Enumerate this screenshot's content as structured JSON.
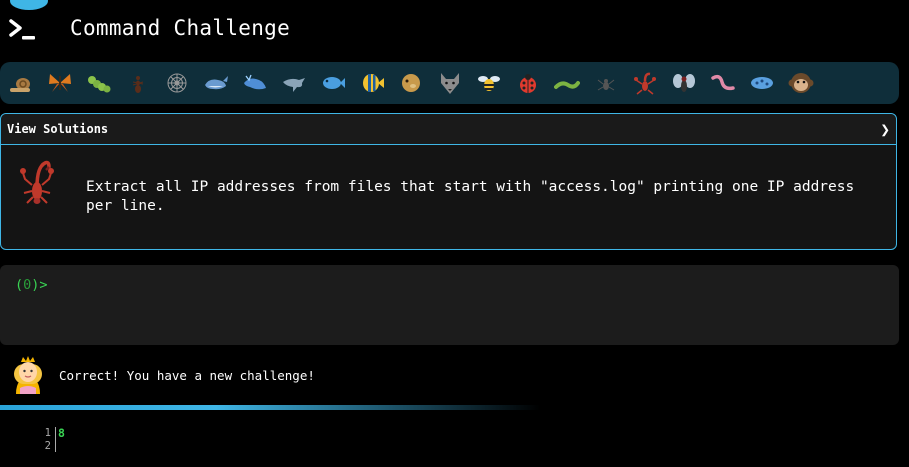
{
  "app": {
    "title": "Command Challenge"
  },
  "icon_strip": [
    "snail-icon",
    "butterfly-icon",
    "caterpillar-icon",
    "ant-icon",
    "spider-web-icon",
    "whale-icon",
    "whale-blue-icon",
    "dolphin-icon",
    "fish-icon",
    "tropical-fish-icon",
    "blowfish-icon",
    "wolf-icon",
    "bee-icon",
    "ladybug-icon",
    "worm-icon",
    "spider-icon",
    "scorpion-icon",
    "fly-icon",
    "earthworm-icon",
    "microbe-icon",
    "monkey-icon"
  ],
  "solutions_panel": {
    "header": "View Solutions",
    "chevron": "❯",
    "challenge": "Extract all IP addresses from files that start with \"access.log\" printing one IP address per line."
  },
  "terminal": {
    "prompt_open": "(",
    "prompt_count": "0",
    "prompt_close": ")>"
  },
  "feedback": {
    "message": "Correct! You have a new challenge!"
  },
  "output": {
    "line_numbers": [
      "1",
      "2"
    ],
    "lines": [
      "8",
      ""
    ]
  },
  "colors": {
    "accent": "#3fb6e6",
    "prompt_green": "#39d353",
    "panel_bg": "#141414",
    "strip_bg": "#0f2e3a"
  }
}
